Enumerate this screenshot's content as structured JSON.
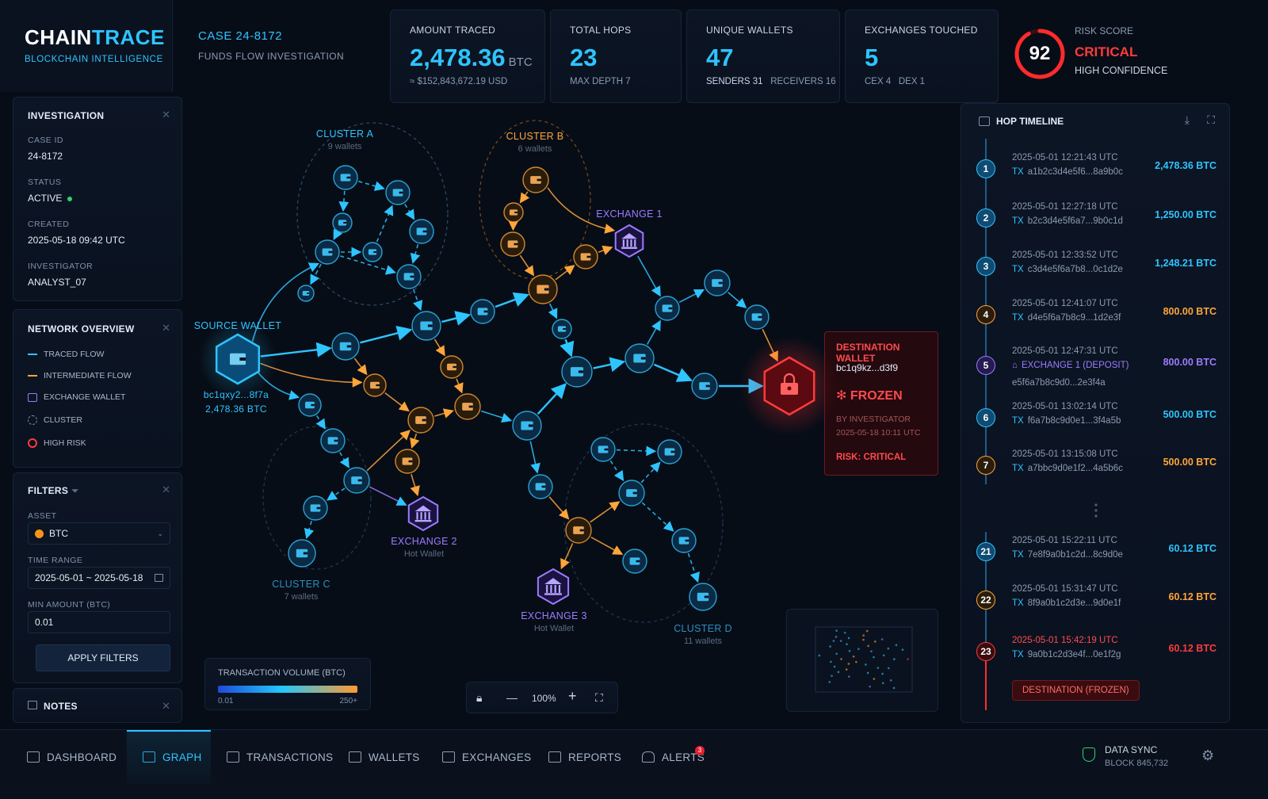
{
  "brand": {
    "name_a": "CHAIN",
    "name_b": "TRACE",
    "tagline": "BLOCKCHAIN INTELLIGENCE"
  },
  "case": {
    "title": "CASE 24-8172",
    "subtitle": "FUNDS FLOW INVESTIGATION"
  },
  "stats": {
    "amount": {
      "label": "AMOUNT TRACED",
      "value": "2,478.36",
      "unit": "BTC",
      "foot": "≈ $152,843,672.19 USD"
    },
    "hops": {
      "label": "TOTAL HOPS",
      "value": "23",
      "foot": "MAX DEPTH 7"
    },
    "wallets": {
      "label": "UNIQUE WALLETS",
      "value": "47",
      "foot_a": "SENDERS 31",
      "foot_b": "RECEIVERS 16"
    },
    "exchanges": {
      "label": "EXCHANGES TOUCHED",
      "value": "5",
      "foot_a": "CEX 4",
      "foot_b": "DEX 1"
    }
  },
  "risk": {
    "label": "RISK SCORE",
    "score": "92",
    "score_fraction": 0.92,
    "level": "CRITICAL",
    "confidence": "HIGH CONFIDENCE"
  },
  "investigation": {
    "title": "INVESTIGATION",
    "case_id_label": "CASE ID",
    "case_id": "24-8172",
    "status_label": "STATUS",
    "status": "ACTIVE",
    "created_label": "CREATED",
    "created": "2025-05-18 09:42 UTC",
    "investigator_label": "INVESTIGATOR",
    "investigator": "ANALYST_07"
  },
  "network": {
    "title": "NETWORK OVERVIEW",
    "legend": [
      "TRACED FLOW",
      "INTERMEDIATE FLOW",
      "EXCHANGE WALLET",
      "CLUSTER",
      "HIGH RISK"
    ]
  },
  "filters": {
    "title": "FILTERS",
    "asset_label": "ASSET",
    "asset": "BTC",
    "range_label": "TIME RANGE",
    "range": "2025-05-01 ~ 2025-05-18",
    "min_label": "MIN AMOUNT (BTC)",
    "min": "0.01",
    "apply": "APPLY FILTERS"
  },
  "notes": {
    "title": "NOTES"
  },
  "graph": {
    "source": {
      "label": "SOURCE WALLET",
      "address": "bc1qxy2...8f7a",
      "amount": "2,478.36 BTC"
    },
    "clusters": [
      {
        "name": "CLUSTER A",
        "sub": "9 wallets"
      },
      {
        "name": "CLUSTER B",
        "sub": "6 wallets"
      },
      {
        "name": "CLUSTER C",
        "sub": "7 wallets"
      },
      {
        "name": "CLUSTER D",
        "sub": "11 wallets"
      }
    ],
    "exchanges": [
      {
        "name": "EXCHANGE 1",
        "sub": ""
      },
      {
        "name": "EXCHANGE 2",
        "sub": "Hot Wallet"
      },
      {
        "name": "EXCHANGE 3",
        "sub": "Hot Wallet"
      }
    ],
    "destination": {
      "label": "DESTINATION WALLET",
      "address": "bc1q9kz...d3f9",
      "state": "FROZEN",
      "by": "BY INVESTIGATOR",
      "when": "2025-05-18 10:11 UTC",
      "risk": "RISK: CRITICAL"
    },
    "volume": {
      "title": "TRANSACTION VOLUME (BTC)",
      "min": "0.01",
      "max": "250+"
    },
    "zoom": "100%"
  },
  "timeline": {
    "title": "HOP TIMELINE",
    "hops": [
      {
        "n": "1",
        "time": "2025-05-01 12:21:43 UTC",
        "tx_key": "TX",
        "tx": "a1b2c3d4e5f6...8a9b0c",
        "amount": "2,478.36 BTC",
        "color": "#2ec4ff"
      },
      {
        "n": "2",
        "time": "2025-05-01 12:27:18 UTC",
        "tx_key": "TX",
        "tx": "b2c3d4e5f6a7...9b0c1d",
        "amount": "1,250.00 BTC",
        "color": "#2ec4ff"
      },
      {
        "n": "3",
        "time": "2025-05-01 12:33:52 UTC",
        "tx_key": "TX",
        "tx": "c3d4e5f6a7b8...0c1d2e",
        "amount": "1,248.21 BTC",
        "color": "#2ec4ff"
      },
      {
        "n": "4",
        "time": "2025-05-01 12:41:07 UTC",
        "tx_key": "TX",
        "tx": "d4e5f6a7b8c9...1d2e3f",
        "amount": "800.00 BTC",
        "color": "#ffa53a"
      },
      {
        "n": "5",
        "time": "2025-05-01 12:47:31 UTC",
        "tx_key": "EXCHANGE 1 (DEPOSIT)",
        "tx": "e5f6a7b8c9d0...2e3f4a",
        "amount": "800.00 BTC",
        "color": "#9b7bff"
      },
      {
        "n": "6",
        "time": "2025-05-01 13:02:14 UTC",
        "tx_key": "TX",
        "tx": "f6a7b8c9d0e1...3f4a5b",
        "amount": "500.00 BTC",
        "color": "#2ec4ff"
      },
      {
        "n": "7",
        "time": "2025-05-01 13:15:08 UTC",
        "tx_key": "TX",
        "tx": "a7bbc9d0e1f2...4a5b6c",
        "amount": "500.00 BTC",
        "color": "#ffa53a"
      },
      {
        "n": "21",
        "time": "2025-05-01 15:22:11 UTC",
        "tx_key": "TX",
        "tx": "7e8f9a0b1c2d...8c9d0e",
        "amount": "60.12 BTC",
        "color": "#2ec4ff"
      },
      {
        "n": "22",
        "time": "2025-05-01 15:31:47 UTC",
        "tx_key": "TX",
        "tx": "8f9a0b1c2d3e...9d0e1f",
        "amount": "60.12 BTC",
        "color": "#ffa53a"
      },
      {
        "n": "23",
        "time": "2025-05-01 15:42:19 UTC",
        "tx_key": "TX",
        "tx": "9a0b1c2d3e4f...0e1f2g",
        "amount": "60.12 BTC",
        "color": "#ff3b3b"
      }
    ],
    "final_badge": "DESTINATION (FROZEN)"
  },
  "nav": {
    "items": [
      "DASHBOARD",
      "GRAPH",
      "TRANSACTIONS",
      "WALLETS",
      "EXCHANGES",
      "REPORTS",
      "ALERTS"
    ],
    "active": "GRAPH",
    "alert_count": "3"
  },
  "sync": {
    "title": "DATA SYNC",
    "block": "BLOCK 845,732"
  },
  "colors": {
    "traced": "#2ec4ff",
    "intermediate": "#ffa53a",
    "exchange": "#9b7bff",
    "risk": "#ff3b3b",
    "active": "#2fd26b"
  }
}
